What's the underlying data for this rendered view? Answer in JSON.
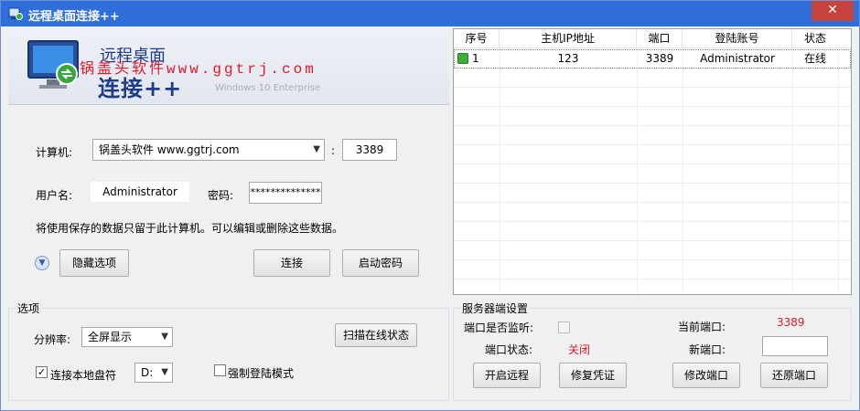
{
  "window": {
    "title": "远程桌面连接++",
    "close_symbol": "✕"
  },
  "banner": {
    "line1": "远程桌面",
    "line2": "连接++",
    "watermark": "锅盖头软件www.ggtrj.com",
    "os_label": "Windows 10 Enterprise"
  },
  "connection": {
    "computer_label": "计算机:",
    "computer_value": "锅盖头软件 www.ggtrj.com",
    "port_sep": ":",
    "port_value": "3389",
    "username_label": "用户名:",
    "username_value": "Administrator",
    "password_label": "密码:",
    "password_value": "**************",
    "notice": "将使用保存的数据只留于此计算机。可以编辑或删除这些数据。",
    "hide_options_label": "隐藏选项",
    "connect_label": "连接",
    "start_password_label": "启动密码"
  },
  "options": {
    "group_title": "选项",
    "resolution_label": "分辨率:",
    "resolution_value": "全屏显示",
    "scan_label": "扫描在线状态",
    "local_disk_label": "连接本地盘符",
    "local_disk_checked": true,
    "drive_value": "D:",
    "force_login_label": "强制登陆模式",
    "force_login_checked": false
  },
  "server": {
    "group_title": "服务器端设置",
    "listen_label": "端口是否监听:",
    "listen_checked": false,
    "port_status_label": "端口状态:",
    "port_status_value": "关闭",
    "current_port_label": "当前端口:",
    "current_port_value": "3389",
    "new_port_label": "新端口:",
    "new_port_value": "",
    "open_remote_label": "开启远程",
    "repair_cred_label": "修复凭证",
    "modify_port_label": "修改端口",
    "restore_port_label": "还原端口"
  },
  "table": {
    "headers": [
      "序号",
      "主机IP地址",
      "端口",
      "登陆账号",
      "状态"
    ],
    "rows": [
      {
        "index": "1",
        "ip": "123",
        "port": "3389",
        "account": "Administrator",
        "status": "在线"
      }
    ]
  },
  "colors": {
    "accent": "#2f6fdc",
    "alert": "#e0182a",
    "online": "#3fae3a"
  }
}
